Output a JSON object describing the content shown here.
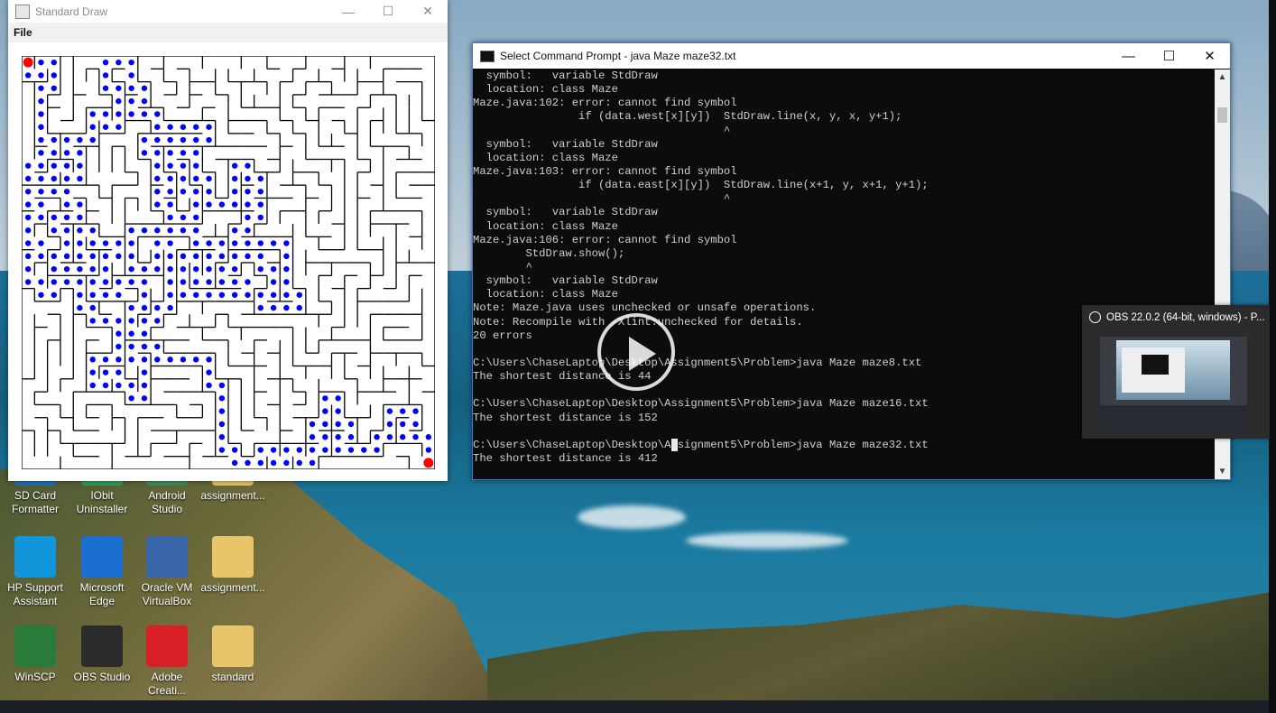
{
  "desktop": {
    "icons": [
      {
        "label": "SD Card Formatter",
        "color": "#1f6fb5"
      },
      {
        "label": "IObit Uninstaller",
        "color": "#2f9e55"
      },
      {
        "label": "Android Studio",
        "color": "#3b8e5a"
      },
      {
        "label": "assignment...",
        "color": "#e8c56a"
      },
      {
        "label": "HP Support Assistant",
        "color": "#1296db"
      },
      {
        "label": "Microsoft Edge",
        "color": "#1b6fcf"
      },
      {
        "label": "Oracle VM VirtualBox",
        "color": "#3a66a8"
      },
      {
        "label": "assignment...",
        "color": "#e8c56a"
      },
      {
        "label": "WinSCP",
        "color": "#2a7a3a"
      },
      {
        "label": "OBS Studio",
        "color": "#2b2b2b"
      },
      {
        "label": "Adobe Creati...",
        "color": "#da1f26"
      },
      {
        "label": "standard",
        "color": "#e8c56a"
      }
    ]
  },
  "std_draw": {
    "title": "Standard Draw",
    "menu_file": "File",
    "maze": {
      "size": 32,
      "wall_color": "#000000",
      "path_color": "#0000ff",
      "goal_color": "#ff0000"
    }
  },
  "cmd": {
    "title": "Select Command Prompt - java  Maze maze32.txt",
    "lines": [
      "  symbol:   variable StdDraw",
      "  location: class Maze",
      "Maze.java:102: error: cannot find symbol",
      "                if (data.west[x][y])  StdDraw.line(x, y, x, y+1);",
      "                                      ^",
      "  symbol:   variable StdDraw",
      "  location: class Maze",
      "Maze.java:103: error: cannot find symbol",
      "                if (data.east[x][y])  StdDraw.line(x+1, y, x+1, y+1);",
      "                                      ^",
      "  symbol:   variable StdDraw",
      "  location: class Maze",
      "Maze.java:106: error: cannot find symbol",
      "        StdDraw.show();",
      "        ^",
      "  symbol:   variable StdDraw",
      "  location: class Maze",
      "Note: Maze.java uses unchecked or unsafe operations.",
      "Note: Recompile with -Xlint:unchecked for details.",
      "20 errors",
      "",
      "C:\\Users\\ChaseLaptop\\Desktop\\Assignment5\\Problem>java Maze maze8.txt",
      "The shortest distance is 44",
      "",
      "C:\\Users\\ChaseLaptop\\Desktop\\Assignment5\\Problem>java Maze maze16.txt",
      "The shortest distance is 152",
      "",
      "C:\\Users\\ChaseLaptop\\Desktop\\Assignment5\\Problem>java Maze maze32.txt",
      "The shortest distance is 412"
    ]
  },
  "obs": {
    "title": "OBS 22.0.2 (64-bit, windows) - P..."
  }
}
